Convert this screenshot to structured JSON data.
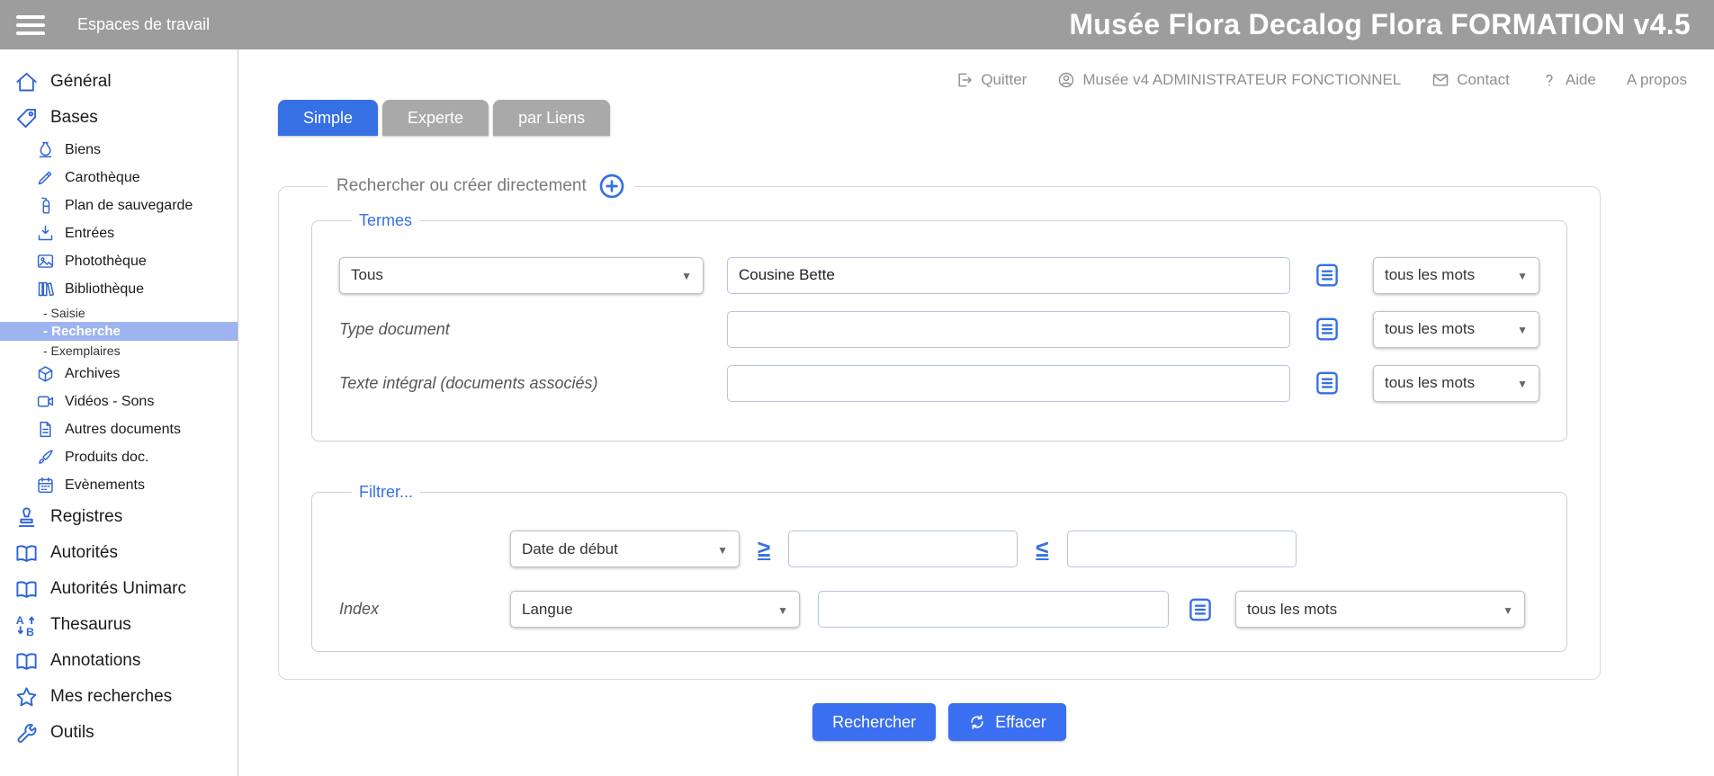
{
  "colors": {
    "accent_blue": "#3570e4",
    "topbar_gray": "#9d9d9d",
    "inactive_tab_gray": "#a9a9a9",
    "selected_item_blue": "#9db4ee"
  },
  "topbar": {
    "workspace_label": "Espaces de travail",
    "app_title": "Musée Flora Decalog Flora FORMATION v4.5"
  },
  "userbar": {
    "quit_label": "Quitter",
    "user_label": "Musée v4 ADMINISTRATEUR FONCTIONNEL",
    "contact_label": "Contact",
    "help_label": "Aide",
    "about_label": "A propos"
  },
  "sidebar": {
    "items": [
      {
        "label": "Général",
        "icon": "home-icon",
        "level": 0
      },
      {
        "label": "Bases",
        "icon": "tag-icon",
        "level": 0
      },
      {
        "label": "Biens",
        "icon": "artifact-icon",
        "level": 1
      },
      {
        "label": "Carothèque",
        "icon": "core-sample-icon",
        "level": 1
      },
      {
        "label": "Plan de sauvegarde",
        "icon": "fire-extinguisher-icon",
        "level": 1
      },
      {
        "label": "Entrées",
        "icon": "inbox-arrow-icon",
        "level": 1
      },
      {
        "label": "Photothèque",
        "icon": "photo-icon",
        "level": 1
      },
      {
        "label": "Bibliothèque",
        "icon": "books-icon",
        "level": 1
      },
      {
        "label": "- Saisie",
        "level": 2
      },
      {
        "label": "- Recherche",
        "level": 2,
        "selected": true
      },
      {
        "label": "- Exemplaires",
        "level": 2
      },
      {
        "label": "Archives",
        "icon": "archive-box-icon",
        "level": 1
      },
      {
        "label": "Vidéos - Sons",
        "icon": "video-icon",
        "level": 1
      },
      {
        "label": "Autres documents",
        "icon": "document-icon",
        "level": 1
      },
      {
        "label": "Produits doc.",
        "icon": "brush-icon",
        "level": 1
      },
      {
        "label": "Evènements",
        "icon": "calendar-icon",
        "level": 1
      },
      {
        "label": "Registres",
        "icon": "stamp-icon",
        "level": 0
      },
      {
        "label": "Autorités",
        "icon": "open-book-icon",
        "level": 0
      },
      {
        "label": "Autorités Unimarc",
        "icon": "open-book-icon",
        "level": 0
      },
      {
        "label": "Thesaurus",
        "icon": "sort-alpha-icon",
        "level": 0
      },
      {
        "label": "Annotations",
        "icon": "open-book-icon",
        "level": 0
      },
      {
        "label": "Mes recherches",
        "icon": "star-icon",
        "level": 0
      },
      {
        "label": "Outils",
        "icon": "wrench-icon",
        "level": 0
      }
    ]
  },
  "tabs": [
    {
      "label": "Simple",
      "active": true
    },
    {
      "label": "Experte",
      "active": false
    },
    {
      "label": "par Liens",
      "active": false
    }
  ],
  "search_panel": {
    "legend": "Rechercher ou créer directement",
    "termes": {
      "legend": "Termes",
      "rows": [
        {
          "field_select": "Tous",
          "value": "Cousine Bette",
          "mode_select": "tous les mots"
        },
        {
          "label": "Type document",
          "value": "",
          "mode_select": "tous les mots"
        },
        {
          "label": "Texte intégral (documents associés)",
          "value": "",
          "mode_select": "tous les mots"
        }
      ]
    },
    "filtrer": {
      "legend": "Filtrer...",
      "date_row": {
        "field_select": "Date de début",
        "gte_symbol": "≥",
        "from_value": "",
        "lte_symbol": "≤",
        "to_value": ""
      },
      "index_row": {
        "label": "Index",
        "field_select": "Langue",
        "value": "",
        "mode_select": "tous les mots"
      }
    }
  },
  "actions": {
    "search_button": "Rechercher",
    "clear_button": "Effacer"
  }
}
